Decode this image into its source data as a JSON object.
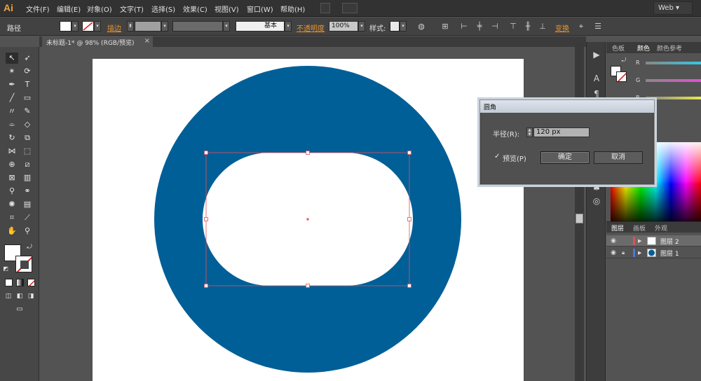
{
  "app": {
    "logo": "Ai",
    "menus": [
      "文件(F)",
      "编辑(E)",
      "对象(O)",
      "文字(T)",
      "选择(S)",
      "效果(C)",
      "视图(V)",
      "窗口(W)",
      "帮助(H)"
    ],
    "workspace": "Web"
  },
  "control_bar": {
    "selection_type": "路径",
    "stroke_label": "描边",
    "stroke_style": "基本",
    "opacity_label": "不透明度",
    "opacity_value": "100%",
    "style_label": "样式:",
    "transform_label": "变换"
  },
  "document": {
    "tab_title": "未标题-1* @ 98% (RGB/预览)",
    "close_symbol": "×"
  },
  "colors": {
    "circle_fill": "#015f97",
    "selection": "#e0505a",
    "artboard": "#ffffff"
  },
  "panels": {
    "color_tabs": [
      "色板",
      "颜色",
      "颜色参考"
    ],
    "active_color_tab": "颜色",
    "sliders": [
      {
        "label": "R",
        "color": "#32c8e8"
      },
      {
        "label": "G",
        "color": "#e84cd8"
      },
      {
        "label": "B",
        "color": "#e8e84c"
      }
    ],
    "layer_tabs": [
      "图层",
      "画板",
      "外观"
    ],
    "layers": [
      {
        "name": "图层 2",
        "color": "#e0505a",
        "selected": true
      },
      {
        "name": "图层 1",
        "color": "#4a78d8",
        "selected": false
      }
    ]
  },
  "dialog": {
    "title": "圆角",
    "radius_label": "半径(R):",
    "radius_value": "120 px",
    "preview_label": "预览(P)",
    "preview_checked": true,
    "ok_label": "确定",
    "cancel_label": "取消"
  }
}
